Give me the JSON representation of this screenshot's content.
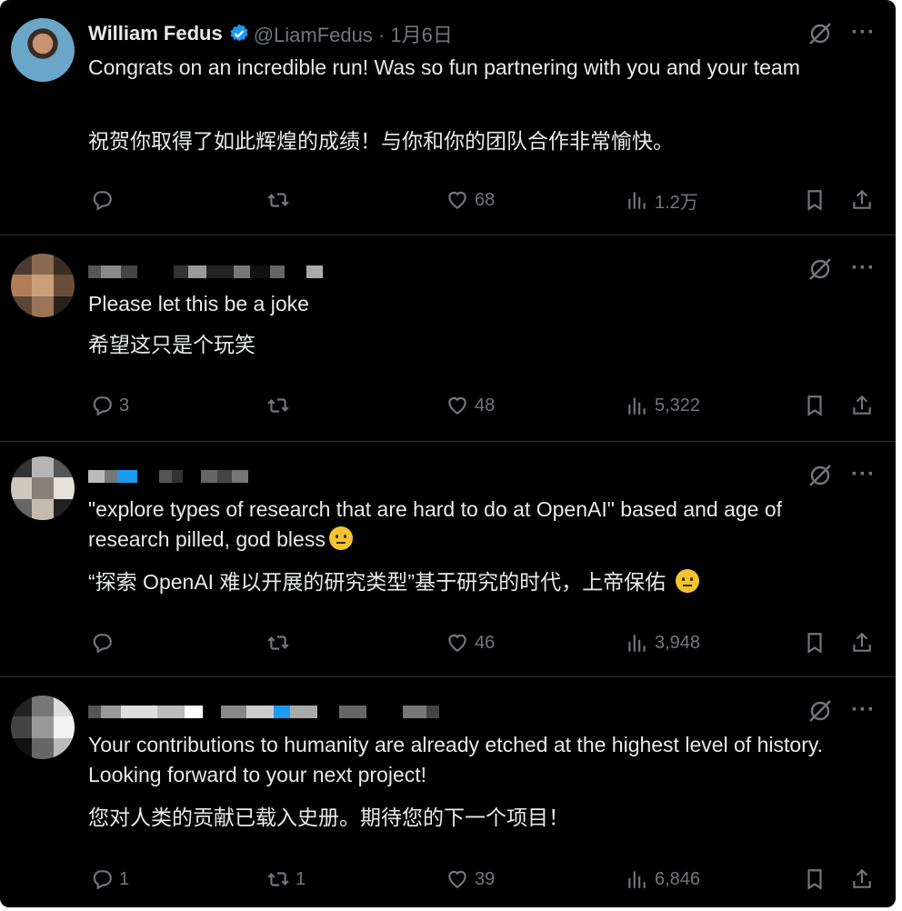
{
  "tweets": [
    {
      "author_name": "William Fedus",
      "handle_date": "@LiamFedus · 1月6日",
      "text_en": "Congrats on an incredible run! Was so fun partnering with you and your team",
      "text_zh": "祝贺你取得了如此辉煌的成绩！与你和你的团队合作非常愉快。",
      "replies": "",
      "retweets": "",
      "likes": "68",
      "views": "1.2万"
    },
    {
      "text_en": "Please let this be a joke",
      "text_zh": "希望这只是个玩笑",
      "replies": "3",
      "retweets": "",
      "likes": "48",
      "views": "5,322"
    },
    {
      "text_en": "\"explore types of research that are hard to do at OpenAI\" based and age of research pilled, god bless",
      "text_zh": "“探索 OpenAI 难以开展的研究类型”基于研究的时代，上帝保佑",
      "replies": "",
      "retweets": "",
      "likes": "46",
      "views": "3,948"
    },
    {
      "text_en": "Your contributions to humanity are already etched at the highest level of history. Looking forward to your next project!",
      "text_zh": "您对人类的贡献已载入史册。期待您的下一个项目！",
      "replies": "1",
      "retweets": "1",
      "likes": "39",
      "views": "6,846"
    }
  ],
  "icons": {
    "verified": "verified-badge-icon",
    "grok": "grok-icon",
    "more": "more-icon",
    "reply": "reply-icon",
    "retweet": "retweet-icon",
    "like": "heart-icon",
    "views": "views-icon",
    "bookmark": "bookmark-icon",
    "share": "share-icon"
  },
  "colors": {
    "background": "#000000",
    "text": "#e7e9ea",
    "muted": "#71767b",
    "divider": "#2f3336",
    "verified": "#1d9bf0"
  }
}
